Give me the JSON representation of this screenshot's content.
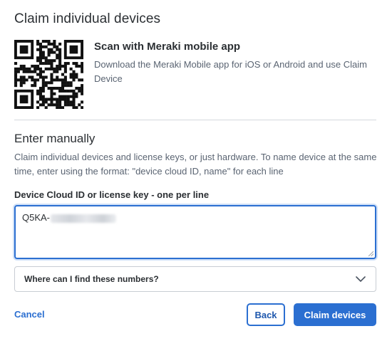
{
  "dialog": {
    "title": "Claim individual devices"
  },
  "scan": {
    "qr_icon": "qr-code-icon",
    "title": "Scan with Meraki mobile app",
    "description": "Download the Meraki Mobile app for iOS or Android and use Claim Device"
  },
  "manual": {
    "title": "Enter manually",
    "description": "Claim individual devices and license keys, or just hardware. To name device at the same time, enter using the format: \"device cloud ID, name\" for each line",
    "field_label": "Device Cloud ID or license key - one per line",
    "field_value_visible": "Q5KA-"
  },
  "help": {
    "label": "Where can I find these numbers?",
    "icon": "chevron-down-icon"
  },
  "actions": {
    "cancel": "Cancel",
    "back": "Back",
    "claim": "Claim devices"
  },
  "colors": {
    "accent": "#2b6fd1",
    "focus_ring": "#cfe0f8",
    "text": "#2b2f33",
    "muted_text": "#5a6472",
    "divider": "#d5d9de"
  }
}
